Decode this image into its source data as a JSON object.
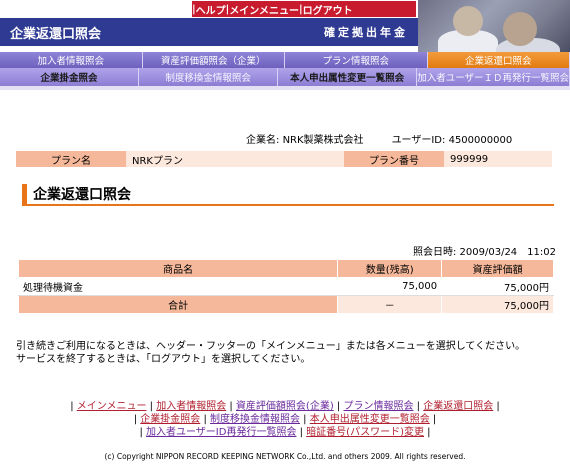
{
  "header": {
    "util_links": [
      "ヘルプ",
      "メインメニュー",
      "ログアウト"
    ],
    "app_title": "企業返還口照会",
    "sub_title": "確定拠出年金"
  },
  "menu": {
    "row1": [
      "加入者情報照会",
      "資産評価額照会（企業）",
      "プラン情報照会",
      "企業返還口照会"
    ],
    "row2": [
      "企業掛金照会",
      "制度移換金情報照会",
      "本人申出属性変更一覧照会",
      "加入者ユーザーＩＤ再発行一覧照会"
    ]
  },
  "info": {
    "company_label": "企業名:",
    "company_value": "NRK製薬株式会社",
    "user_label": "ユーザーID:",
    "user_value": "4500000000",
    "plan_name_label": "プラン名",
    "plan_name_value": "NRKプラン",
    "plan_no_label": "プラン番号",
    "plan_no_value": "999999"
  },
  "section_title": "企業返還口照会",
  "date": {
    "label": "照会日時:",
    "value": "2009/03/24　11:02"
  },
  "table": {
    "headers": [
      "商品名",
      "数量(残高)",
      "資産評価額"
    ],
    "rows": [
      {
        "name": "処理待機資金",
        "qty": "75,000",
        "amount": "75,000円"
      }
    ],
    "total": {
      "label": "合計",
      "qty": "－",
      "amount": "75,000円"
    }
  },
  "message": {
    "line1": "引き続きご利用になるときは、ヘッダー・フッターの「メインメニュー」または各メニューを選択してください。",
    "line2": "サービスを終了するときは、「ログアウト」を選択してください。"
  },
  "footer": {
    "line1": [
      "メインメニュー",
      "加入者情報照会",
      "資産評価額照会(企業)",
      "プラン情報照会",
      "企業返還口照会"
    ],
    "line2": [
      "企業掛金照会",
      "制度移換金情報照会",
      "本人申出属性変更一覧照会"
    ],
    "line3": [
      "加入者ユーザーID再発行一覧照会",
      "暗証番号(パスワード)変更"
    ],
    "copyright": "(c) Copyright NIPPON RECORD KEEPING NETWORK Co.,Ltd. and others 2009.  All rights reserved."
  },
  "colors": {
    "util_red": "#c81c2e",
    "title_blue": "#2f3a93",
    "menu_purple": "#7b6fc8",
    "active_orange": "#e8751a",
    "table_header": "#f5b89a",
    "table_light": "#fde8dd"
  }
}
